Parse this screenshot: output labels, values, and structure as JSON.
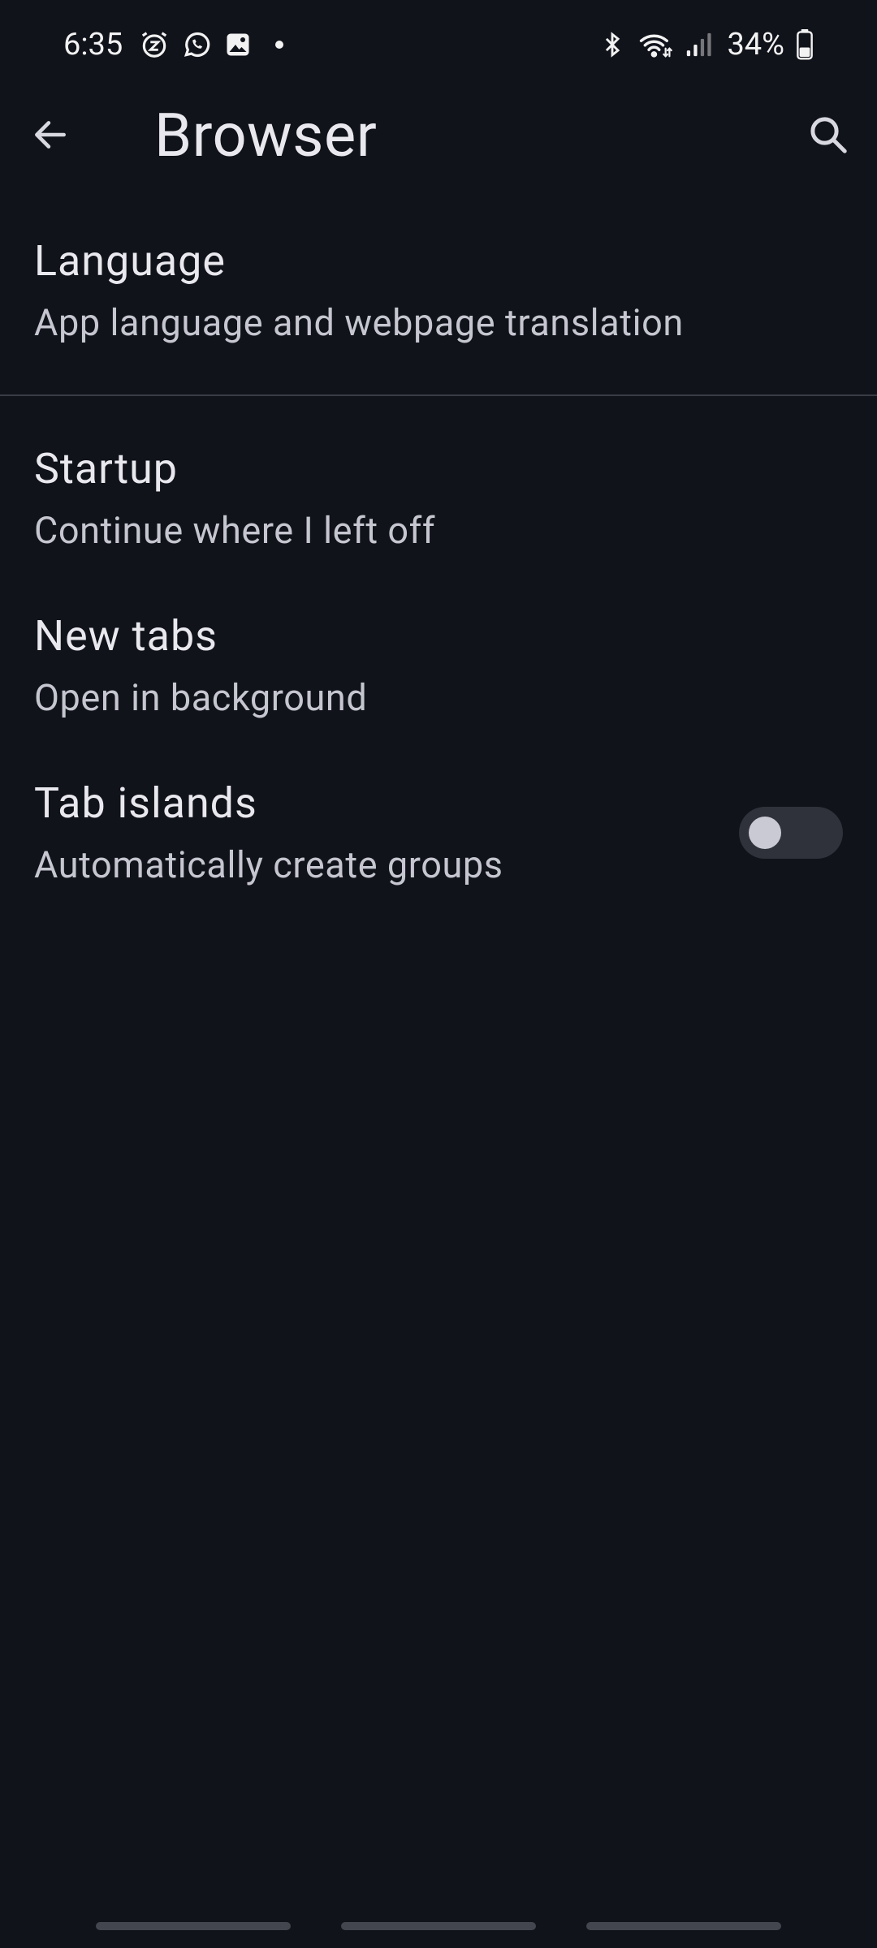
{
  "status_bar": {
    "time": "6:35",
    "battery_percent": "34%",
    "icons": [
      "alarm-icon",
      "whatsapp-icon",
      "gallery-icon",
      "notification-dot",
      "bluetooth-icon",
      "wifi-icon",
      "signal-icon",
      "battery-icon"
    ]
  },
  "app_bar": {
    "title": "Browser",
    "back_icon": "arrow-back-icon",
    "search_icon": "search-icon"
  },
  "settings": {
    "language": {
      "title": "Language",
      "summary": "App language and webpage translation"
    },
    "startup": {
      "title": "Startup",
      "summary": "Continue where I left off"
    },
    "new_tabs": {
      "title": "New tabs",
      "summary": "Open in background"
    },
    "tab_islands": {
      "title": "Tab islands",
      "summary": "Automatically create groups",
      "enabled": false
    }
  },
  "colors": {
    "background": "#11131b",
    "text_primary": "#e8e8ee",
    "text_secondary": "#c5c6cf",
    "divider": "#3a3c45",
    "toggle_track_off": "#30323b",
    "toggle_knob_off": "#c9cad3"
  }
}
